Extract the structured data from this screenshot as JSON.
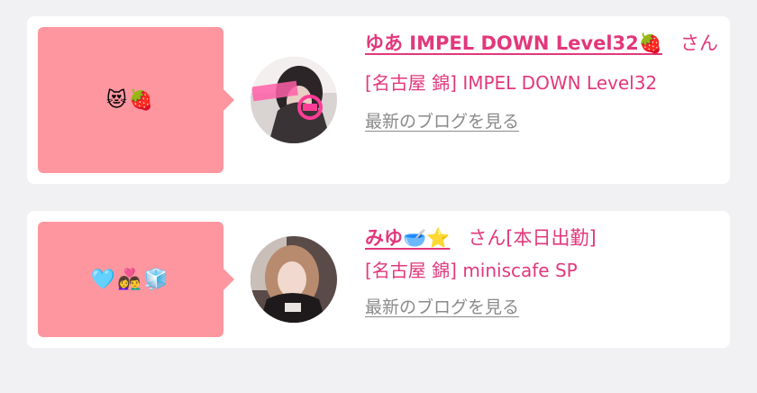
{
  "cards": [
    {
      "bubble_emoji": "😻🍓",
      "name": "ゆあ IMPEL DOWN Level32🍓",
      "honorific": "さん",
      "status": "",
      "shop": "[名古屋 錦] IMPEL DOWN Level32",
      "blog_link": "最新のブログを見る"
    },
    {
      "bubble_emoji": "🩵👩‍❤️‍👨🧊",
      "name": "みゆ🥣⭐️",
      "honorific": "さん",
      "status": "[本日出勤]",
      "shop": "[名古屋 錦] miniscafe SP",
      "blog_link": "最新のブログを見る"
    }
  ],
  "colors": {
    "accent": "#e2387c",
    "bubble": "#fe96a0",
    "muted": "#8a8a8a"
  },
  "icons": {
    "avatar1": "avatar-photo",
    "avatar2": "avatar-photo"
  }
}
